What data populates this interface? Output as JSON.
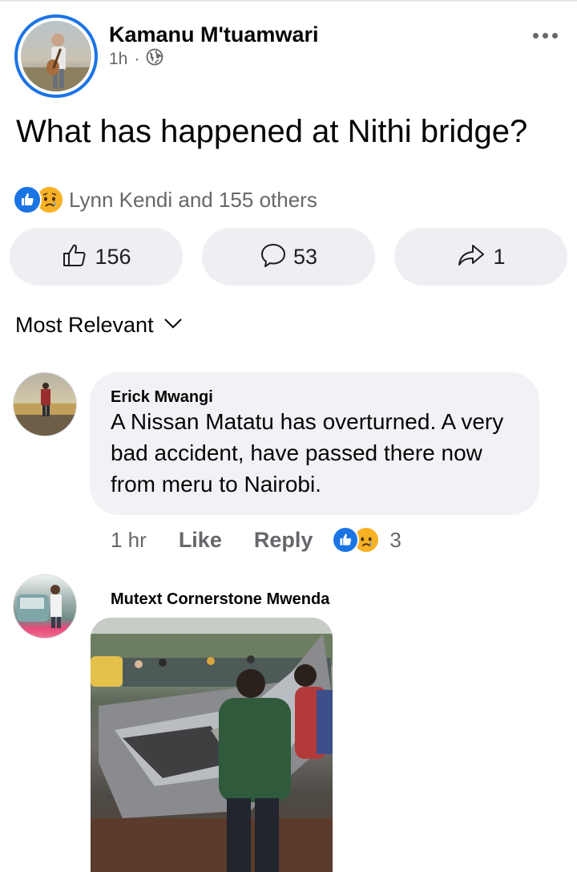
{
  "post": {
    "author_name": "Kamanu M'tuamwari",
    "time": "1h",
    "separator": "·",
    "privacy_icon": "globe-icon",
    "more_icon": "more-dots-icon",
    "text": "What has happened at Nithi bridge?"
  },
  "reactions": {
    "icons": [
      "like-reaction-icon",
      "sad-reaction-icon"
    ],
    "summary": "Lynn Kendi and 155 others"
  },
  "actions": {
    "like_count": "156",
    "comment_count": "53",
    "share_count": "1"
  },
  "sort": {
    "label": "Most Relevant"
  },
  "comments": [
    {
      "name": "Erick Mwangi",
      "lines": [
        "A Nissan Matatu has overturned. A very",
        "bad accident, have passed there now",
        "from meru to Nairobi."
      ],
      "time": "1 hr",
      "like_label": "Like",
      "reply_label": "Reply",
      "reaction_count": "3"
    },
    {
      "name": "Mutext Cornerstone Mwenda",
      "has_photo": true
    }
  ],
  "colors": {
    "brand_blue": "#1b74e4",
    "sad_yellow": "#f7b125",
    "secondary_text": "#65676b",
    "pill_bg": "#eeeff2",
    "bubble_bg": "#f0f2f5"
  }
}
